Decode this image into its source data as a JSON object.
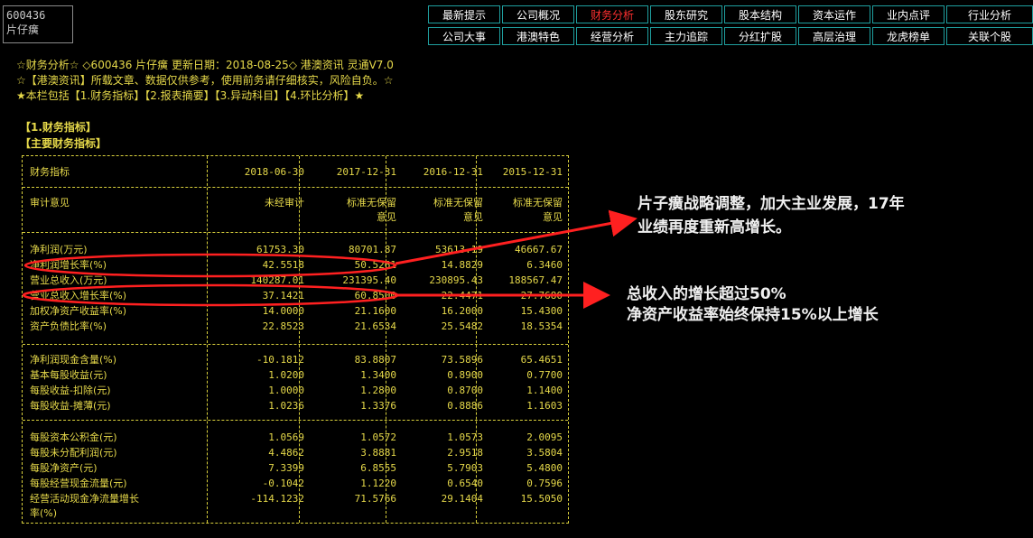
{
  "stock": {
    "code": "600436",
    "name": "片仔癀"
  },
  "tabs_row1": [
    "最新提示",
    "公司概况",
    "财务分析",
    "股东研究",
    "股本结构",
    "资本运作",
    "业内点评",
    "行业分析"
  ],
  "tabs_row2": [
    "公司大事",
    "港澳特色",
    "经营分析",
    "主力追踪",
    "分红扩股",
    "高层治理",
    "龙虎榜单",
    "关联个股"
  ],
  "active_tab": "财务分析",
  "header": {
    "line1": "☆财务分析☆ ◇600436 片仔癀 更新日期：2018-08-25◇ 港澳资讯 灵通V7.0",
    "line2": "☆【港澳资讯】所载文章、数据仅供参考，使用前务请仔细核实，风险自负。☆",
    "line3": "★本栏包括【1.财务指标】【2.报表摘要】【3.异动科目】【4.环比分析】★"
  },
  "sections": {
    "s1": "【1.财务指标】",
    "s2": "【主要财务指标】"
  },
  "table": {
    "headers": [
      "财务指标",
      "2018-06-30",
      "2017-12-31",
      "2016-12-31",
      "2015-12-31"
    ],
    "audit": {
      "label": "审计意见",
      "v1": "未经审计",
      "v2a": "标准无保留",
      "v2b": "意见",
      "v3a": "标准无保留",
      "v3b": "意见",
      "v4a": "标准无保留",
      "v4b": "意见"
    },
    "group1": [
      [
        "净利润(万元)",
        "61753.30",
        "80701.87",
        "53613.19",
        "46667.67"
      ],
      [
        "净利润增长率(%)",
        "42.5518",
        "50.5261",
        "14.8829",
        "6.3460"
      ],
      [
        "营业总收入(万元)",
        "140287.01",
        "231395.40",
        "230895.43",
        "188567.47"
      ],
      [
        "营业总收入增长率(%)",
        "37.1421",
        "60.8500",
        "22.4471",
        "27.7680"
      ],
      [
        "加权净资产收益率(%)",
        "14.0000",
        "21.1600",
        "16.2000",
        "15.4300"
      ],
      [
        "资产负债比率(%)",
        "22.8523",
        "21.6534",
        "25.5482",
        "18.5354"
      ]
    ],
    "group2": [
      [
        "净利润现金含量(%)",
        "-10.1812",
        "83.8807",
        "73.5896",
        "65.4651"
      ],
      [
        "基本每股收益(元)",
        "1.0200",
        "1.3400",
        "0.8900",
        "0.7700"
      ],
      [
        "每股收益-扣除(元)",
        "1.0000",
        "1.2800",
        "0.8700",
        "1.1400"
      ],
      [
        "每股收益-摊薄(元)",
        "1.0236",
        "1.3376",
        "0.8886",
        "1.1603"
      ]
    ],
    "group3": [
      [
        "每股资本公积金(元)",
        "1.0569",
        "1.0572",
        "1.0573",
        "2.0095"
      ],
      [
        "每股未分配利润(元)",
        "4.4862",
        "3.8881",
        "2.9518",
        "3.5804"
      ],
      [
        "每股净资产(元)",
        "7.3399",
        "6.8555",
        "5.7903",
        "5.4800"
      ],
      [
        "每股经营现金流量(元)",
        "-0.1042",
        "1.1220",
        "0.6540",
        "0.7596"
      ],
      [
        "经营活动现金净流量增长",
        "-114.1232",
        "71.5766",
        "29.1404",
        "15.5050"
      ]
    ],
    "last_label_wrap": "率(%)"
  },
  "annotations": {
    "a1_line1": "片子癀战略调整，加大主业发展，17年",
    "a1_line2": "业绩再度重新高增长。",
    "a2_line1": "总收入的增长超过50%",
    "a2_line2": "净资产收益率始终保持15%以上增长"
  },
  "colors": {
    "text": "#e6d94a",
    "accent": "#ff2020",
    "tab_border": "#1f9f9f"
  }
}
